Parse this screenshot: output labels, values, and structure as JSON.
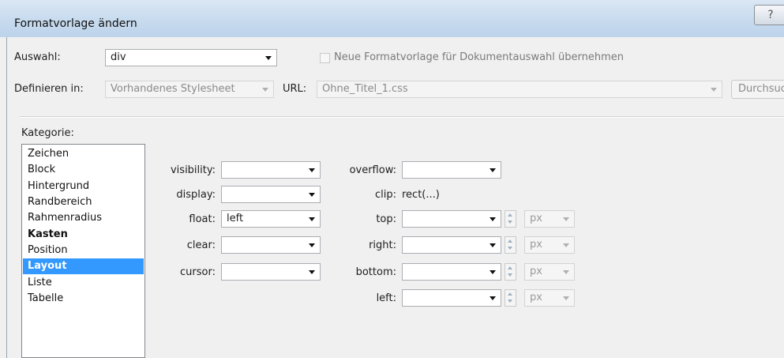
{
  "window": {
    "title": "Formatvorlage ändern",
    "help": "?"
  },
  "top": {
    "selection_label": "Auswahl:",
    "selection_value": "div",
    "new_style_checkbox_label": "Neue Formatvorlage für Dokumentauswahl übernehmen",
    "new_style_checked": false,
    "define_in_label": "Definieren in:",
    "define_in_value": "Vorhandenes Stylesheet",
    "url_label": "URL:",
    "url_value": "Ohne_Titel_1.css",
    "browse_label": "Durchsuc"
  },
  "category": {
    "label": "Kategorie:",
    "items": [
      {
        "label": "Zeichen"
      },
      {
        "label": "Block"
      },
      {
        "label": "Hintergrund"
      },
      {
        "label": "Randbereich"
      },
      {
        "label": "Rahmenradius"
      },
      {
        "label": "Kasten",
        "bold": true
      },
      {
        "label": "Position"
      },
      {
        "label": "Layout",
        "selected": true
      },
      {
        "label": "Liste"
      },
      {
        "label": "Tabelle"
      }
    ]
  },
  "layout": {
    "visibility": {
      "label": "visibility:",
      "value": ""
    },
    "display": {
      "label": "display:",
      "value": ""
    },
    "float": {
      "label": "float:",
      "value": "left"
    },
    "clear": {
      "label": "clear:",
      "value": ""
    },
    "cursor": {
      "label": "cursor:",
      "value": ""
    },
    "overflow": {
      "label": "overflow:",
      "value": ""
    },
    "clip": {
      "label": "clip:",
      "value": "rect(...)"
    },
    "top": {
      "label": "top:",
      "value": "",
      "unit": "px"
    },
    "right": {
      "label": "right:",
      "value": "",
      "unit": "px"
    },
    "bottom": {
      "label": "bottom:",
      "value": "",
      "unit": "px"
    },
    "left": {
      "label": "left:",
      "value": "",
      "unit": "px"
    }
  },
  "colors": {
    "selection": "#3399ff",
    "titlebar": "#c9dcef"
  }
}
